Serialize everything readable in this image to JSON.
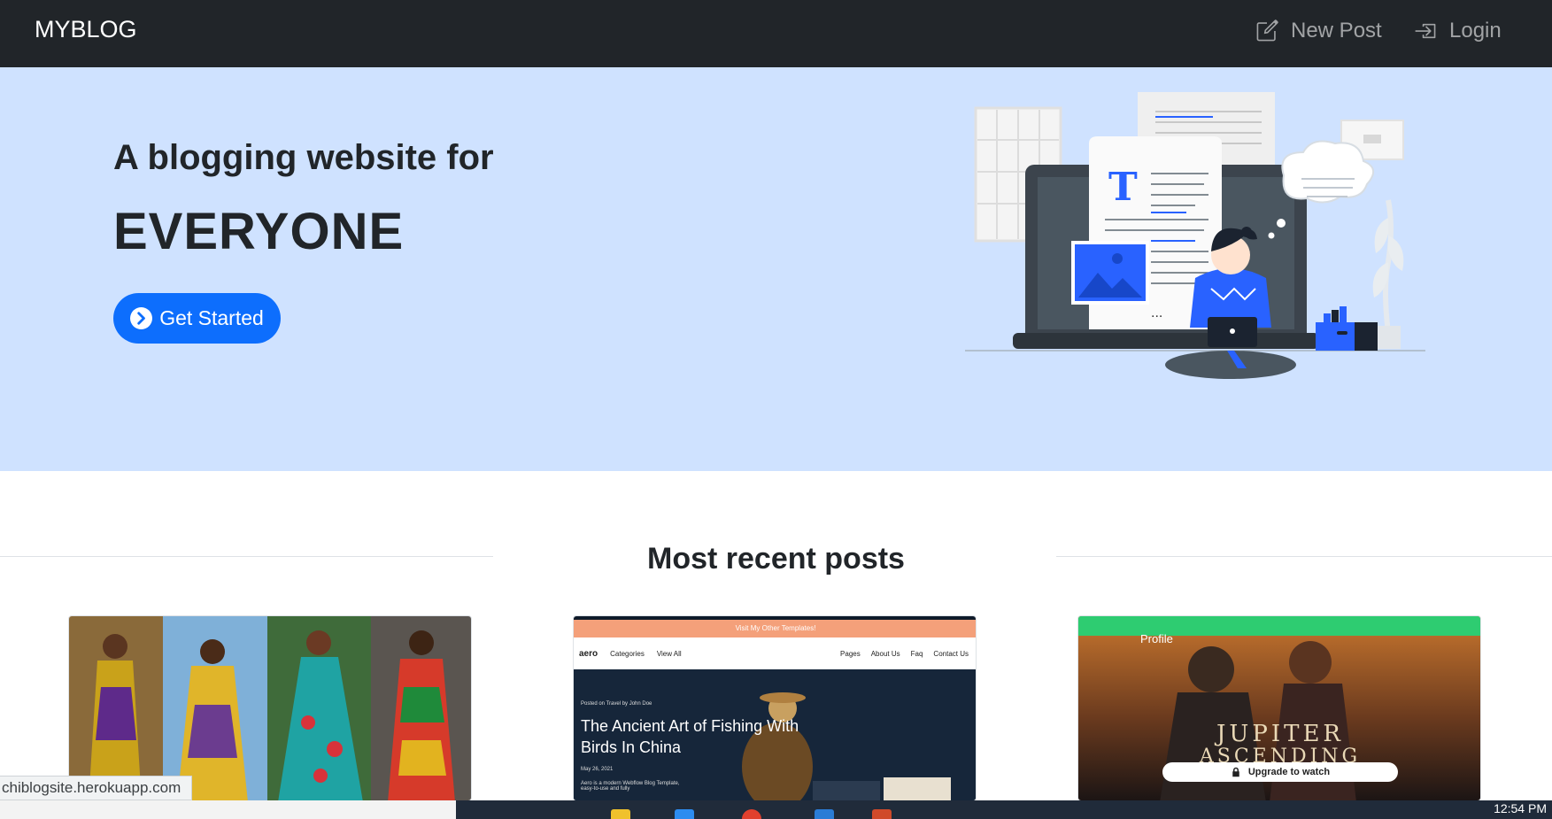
{
  "navbar": {
    "brand": "MYBLOG",
    "new_post_label": "New Post",
    "login_label": "Login",
    "new_post_icon": "pencil-square-icon",
    "login_icon": "box-arrow-in-right-icon"
  },
  "hero": {
    "line1": "A blogging website for",
    "line2": "EVERYONE",
    "cta_label": "Get Started",
    "cta_icon": "chevron-circle-right-icon"
  },
  "recent": {
    "title": "Most recent posts"
  },
  "cards": [
    {
      "image": "african-fashion-collage"
    },
    {
      "image": "aero-blog-template",
      "banner": "Visit My Other Templates!",
      "nav_left": [
        "aero",
        "Categories",
        "View All"
      ],
      "nav_right": [
        "Pages",
        "About Us",
        "Faq",
        "Contact Us"
      ],
      "posted": "Posted on Travel by John Doe",
      "headline": "The Ancient Art of Fishing With Birds In China",
      "date": "May 26, 2021",
      "blurb": "Aero is a modern Webflow Blog Template, easy-to-use and fully"
    },
    {
      "image": "movie-streaming-app",
      "profile": "Profile",
      "movie_line1": "JUPITER",
      "movie_line2": "ASCENDING",
      "upgrade": "Upgrade to watch"
    }
  ],
  "status_bar": {
    "url": "chiblogsite.herokuapp.com"
  },
  "taskbar": {
    "clock": "12:54 PM"
  },
  "colors": {
    "navbar_bg": "#212529",
    "hero_bg": "#cfe2ff",
    "primary": "#0d6efd"
  }
}
